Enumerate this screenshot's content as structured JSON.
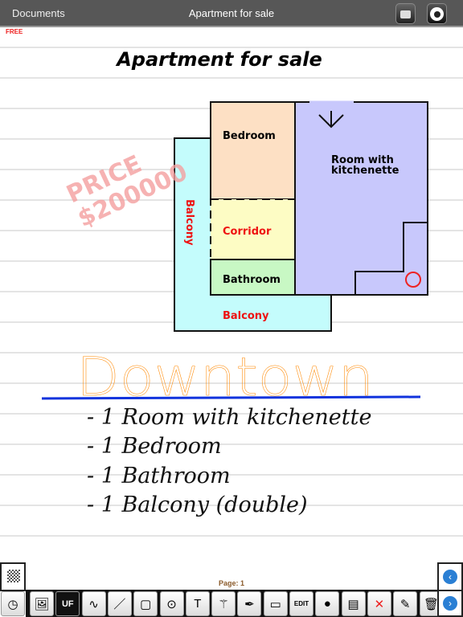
{
  "header": {
    "back_label": "Documents",
    "title": "Apartment for sale",
    "print_icon": "print-icon",
    "record_icon": "record-icon"
  },
  "badge": "FREE",
  "note": {
    "title": "Apartment for sale",
    "stamp": [
      "PRICE",
      "$200000"
    ],
    "rooms": {
      "bedroom": "Bedroom",
      "room": [
        "Room with",
        "kitchenette"
      ],
      "corridor": "Corridor",
      "bathroom": "Bathroom",
      "balcony_side": "Balcony",
      "balcony_bottom": "Balcony"
    },
    "handwriting": "Downtown",
    "list": [
      "- 1 Room with kitchenette",
      "- 1 Bedroom",
      "- 1 Bathroom",
      "- 1 Balcony (double)"
    ]
  },
  "footer": {
    "page_label": "Page: 1"
  },
  "tools": [
    "clock",
    "image",
    "UF",
    "curve",
    "line",
    "rectangle",
    "circle",
    "T",
    "wand",
    "pen",
    "eraser",
    "EDIT",
    "camera",
    "background",
    "delete-background",
    "paste",
    "trash"
  ],
  "colors": {
    "bedroom": "#fde0c4",
    "corridor": "#fdfcc4",
    "bathroom": "#c8f8c4",
    "room": "#c8c8fc",
    "balcony": "#c4fcfc",
    "handwriting": "#ff8800",
    "underline": "#1133dd"
  }
}
